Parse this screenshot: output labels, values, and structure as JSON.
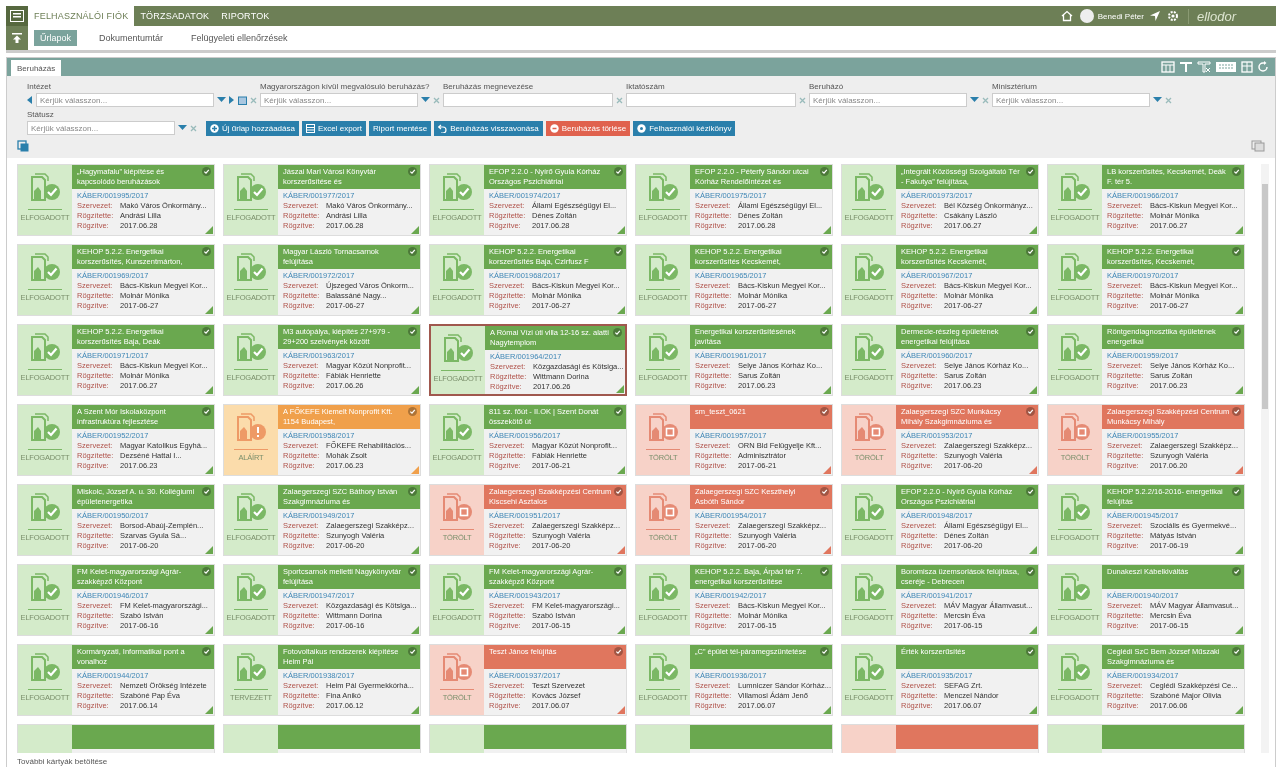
{
  "top_bar": {
    "tabs": [
      {
        "label": "FELHASZNÁLÓI FIÓK",
        "selected": true
      },
      {
        "label": "TÖRZSADATOK",
        "selected": false
      },
      {
        "label": "RIPORTOK",
        "selected": false
      }
    ],
    "user": "Benedi Péter",
    "logo": "ellodor"
  },
  "sub_nav": {
    "tabs": [
      {
        "label": "Űrlapok",
        "selected": true
      },
      {
        "label": "Dokumentumtár",
        "selected": false
      },
      {
        "label": "Felügyeleti ellenőrzések",
        "selected": false
      }
    ]
  },
  "panel": {
    "tab": "Beruházás"
  },
  "filters": [
    {
      "label": "Intézet",
      "placeholder": "Kérjük válasszon...",
      "kind": "nav-select"
    },
    {
      "label": "Magyarországon kívül megvalósuló beruházás?",
      "placeholder": "Kérjük válasszon...",
      "kind": "select"
    },
    {
      "label": "Beruházás megnevezése",
      "kind": "text"
    },
    {
      "label": "Iktatószám",
      "kind": "text"
    },
    {
      "label": "Beruházó",
      "placeholder": "Kérjük válasszon...",
      "kind": "select"
    },
    {
      "label": "Minisztérium",
      "placeholder": "Kérjük válasszon...",
      "kind": "select"
    },
    {
      "label": "Státusz",
      "placeholder": "Kérjük válasszon...",
      "kind": "select"
    }
  ],
  "actions": [
    {
      "label": "Új űrlap hozzáadása",
      "kind": "add",
      "color": "#2a7fab"
    },
    {
      "label": "Excel export",
      "kind": "excel",
      "color": "#2a7fab"
    },
    {
      "label": "Riport mentése",
      "kind": "plain",
      "color": "#2a7fab"
    },
    {
      "label": "Beruházás visszavonása",
      "kind": "undo",
      "color": "#2a7fab"
    },
    {
      "label": "Beruházás törlése",
      "kind": "delete",
      "color": "#e0624e"
    },
    {
      "label": "Felhasználói kézikönyv",
      "kind": "help",
      "color": "#2a7fab"
    }
  ],
  "cards": [
    {
      "kind": "accepted",
      "status_label": "ELFOGADOTT",
      "selected": false,
      "title": "„Hagymafalu” kiépítése és kapcsolódó beruházások",
      "id": "KÁBER/001995/2017",
      "org_label": "Szervezet:",
      "org": "Makó Város Önkormány...",
      "by_label": "Rögzítette:",
      "by": "Andrási Lilla",
      "date_label": "Rögzítve:",
      "date": "2017.06.28"
    },
    {
      "kind": "accepted",
      "status_label": "ELFOGADOTT",
      "selected": false,
      "title": "Jászai Mari Városi Könyvtár korszerűsítése és",
      "id": "KÁBER/001977/2017",
      "org_label": "Szervezet:",
      "org": "Makó Város Önkormány...",
      "by_label": "Rögzítette:",
      "by": "Andrási Lilla",
      "date_label": "Rögzítve:",
      "date": "2017.06.28"
    },
    {
      "kind": "accepted",
      "status_label": "ELFOGADOTT",
      "selected": false,
      "title": "EFOP 2.2.0 - Nyírő Gyula Kórház Országos Pszichiátriai",
      "id": "KÁBER/001974/2017",
      "org_label": "Szervezet:",
      "org": "Állami Egészségügyi El...",
      "by_label": "Rögzítette:",
      "by": "Dénes Zoltán",
      "date_label": "Rögzítve:",
      "date": "2017.06.28"
    },
    {
      "kind": "accepted",
      "status_label": "ELFOGADOTT",
      "selected": false,
      "title": "EFOP 2.2.0 - Péterfy Sándor utcai Kórház Rendelőintézet és",
      "id": "KÁBER/001975/2017",
      "org_label": "Szervezet:",
      "org": "Állami Egészségügyi El...",
      "by_label": "Rögzítette:",
      "by": "Dénes Zoltán",
      "date_label": "Rögzítve:",
      "date": "2017.06.28"
    },
    {
      "kind": "accepted",
      "status_label": "ELFOGADOTT",
      "selected": false,
      "title": "„Integrált Közösségi Szolgáltató Tér - Fakutya” felújítása,",
      "id": "KÁBER/001973/2017",
      "org_label": "Szervezet:",
      "org": "Bél Község Önkormányz...",
      "by_label": "Rögzítette:",
      "by": "Csákány László",
      "date_label": "Rögzítve:",
      "date": "2017.06.27"
    },
    {
      "kind": "accepted",
      "status_label": "ELFOGADOTT",
      "selected": false,
      "title": "LB korszerűsítés, Kecskemét, Deák F. tér 5.",
      "id": "KÁBER/001966/2017",
      "org_label": "Szervezet:",
      "org": "Bács-Kiskun Megyei Kor...",
      "by_label": "Rögzítette:",
      "by": "Molnár Mónika",
      "date_label": "Rögzítve:",
      "date": "2017.06.27"
    },
    {
      "kind": "accepted",
      "status_label": "ELFOGADOTT",
      "selected": false,
      "title": "KEHOP 5.2.2. Energetikai korszerűsítés, Kunszentmárton,",
      "id": "KÁBER/001969/2017",
      "org_label": "Szervezet:",
      "org": "Bács-Kiskun Megyei Kor...",
      "by_label": "Rögzítette:",
      "by": "Molnár Mónika",
      "date_label": "Rögzítve:",
      "date": "2017-06-27"
    },
    {
      "kind": "accepted",
      "status_label": "ELFOGADOTT",
      "selected": false,
      "title": "Magyar László Tornacsarnok felújítása",
      "id": "KÁBER/001972/2017",
      "org_label": "Szervezet:",
      "org": "Újszeged Város Önkorm...",
      "by_label": "Rögzítette:",
      "by": "Balassáné Nagy...",
      "date_label": "Rögzítve:",
      "date": "2017-06-27"
    },
    {
      "kind": "accepted",
      "status_label": "ELFOGADOTT",
      "selected": false,
      "title": "KEHOP 5.2.2. Energetikai korszerűsítés Baja, Czirfusz F",
      "id": "KÁBER/001968/2017",
      "org_label": "Szervezet:",
      "org": "Bács-Kiskun Megyei Kor...",
      "by_label": "Rögzítette:",
      "by": "Molnár Mónika",
      "date_label": "Rögzítve:",
      "date": "2017-06-27"
    },
    {
      "kind": "accepted",
      "status_label": "ELFOGADOTT",
      "selected": false,
      "title": "KEHOP 5.2.2. Energetikai korszerűsítés Kecskemét,",
      "id": "KÁBER/001965/2017",
      "org_label": "Szervezet:",
      "org": "Bács-Kiskun Megyei Kor...",
      "by_label": "Rögzítette:",
      "by": "Molnár Mónika",
      "date_label": "Rögzítve:",
      "date": "2017-06-27"
    },
    {
      "kind": "accepted",
      "status_label": "ELFOGADOTT",
      "selected": false,
      "title": "KEHOP 5.2.2. Energetikai korszerűsítés Kecskemét,",
      "id": "KÁBER/001967/2017",
      "org_label": "Szervezet:",
      "org": "Bács-Kiskun Megyei Kor...",
      "by_label": "Rögzítette:",
      "by": "Molnár Mónika",
      "date_label": "Rögzítve:",
      "date": "2017-06-27"
    },
    {
      "kind": "accepted",
      "status_label": "ELFOGADOTT",
      "selected": false,
      "title": "KEHOP 5.2.2. Energetikai korszerűsítés, Kecskemét,",
      "id": "KÁBER/001970/2017",
      "org_label": "Szervezet:",
      "org": "Bács-Kiskun Megyei Kor...",
      "by_label": "Rögzítette:",
      "by": "Molnár Mónika",
      "date_label": "Rögzítve:",
      "date": "2017-06-27"
    },
    {
      "kind": "accepted",
      "status_label": "ELFOGADOTT",
      "selected": false,
      "title": "KEHOP 5.2.2. Energetikai korszerűsítés Baja, Deák",
      "id": "KÁBER/001971/2017",
      "org_label": "Szervezet:",
      "org": "Bács-Kiskun Megyei Kor...",
      "by_label": "Rögzítette:",
      "by": "Molnár Mónika",
      "date_label": "Rögzítve:",
      "date": "2017.06.27"
    },
    {
      "kind": "accepted",
      "status_label": "ELFOGADOTT",
      "selected": false,
      "title": "M3 autópálya, kiépítés 27+979 - 29+200 szelvények között",
      "id": "KÁBER/001963/2017",
      "org_label": "Szervezet:",
      "org": "Magyar Közút Nonprofit...",
      "by_label": "Rögzítette:",
      "by": "Fábiák Henriette",
      "date_label": "Rögzítve:",
      "date": "2017.06.26"
    },
    {
      "kind": "accepted",
      "status_label": "ELFOGADOTT",
      "selected": true,
      "title": "A Római Vízi úti villa 12-16 sz. alatti Nagytemplom",
      "id": "KÁBER/001964/2017",
      "org_label": "Szervezet:",
      "org": "Közgazdasági és Kötsiga...",
      "by_label": "Rögzítette:",
      "by": "Wittmann Dorina",
      "date_label": "Rögzítve:",
      "date": "2017.06.26"
    },
    {
      "kind": "accepted",
      "status_label": "ELFOGADOTT",
      "selected": false,
      "title": "Energetikai korszerűsítésének javítása",
      "id": "KÁBER/001961/2017",
      "org_label": "Szervezet:",
      "org": "Selye János Kórház Ko...",
      "by_label": "Rögzítette:",
      "by": "Sarus Zoltán",
      "date_label": "Rögzítve:",
      "date": "2017.06.23"
    },
    {
      "kind": "accepted",
      "status_label": "ELFOGADOTT",
      "selected": false,
      "title": "Dermecie-részleg épületének energetikai felújítása",
      "id": "KÁBER/001960/2017",
      "org_label": "Szervezet:",
      "org": "Selye János Kórház Ko...",
      "by_label": "Rögzítette:",
      "by": "Sarus Zoltán",
      "date_label": "Rögzítve:",
      "date": "2017.06.23"
    },
    {
      "kind": "accepted",
      "status_label": "ELFOGADOTT",
      "selected": false,
      "title": "Röntgendiagnosztika épületének energetikai",
      "id": "KÁBER/001959/2017",
      "org_label": "Szervezet:",
      "org": "Selye János Kórház Ko...",
      "by_label": "Rögzítette:",
      "by": "Sarus Zoltán",
      "date_label": "Rögzítve:",
      "date": "2017.06.23"
    },
    {
      "kind": "accepted",
      "status_label": "ELFOGADOTT",
      "selected": false,
      "title": "A Szent Mór Iskolaközpont infrastruktúra fejlesztése",
      "id": "KÁBER/001952/2017",
      "org_label": "Szervezet:",
      "org": "Magyar Katolikus Egyhá...",
      "by_label": "Rögzítette:",
      "by": "Dezséné Hattal I...",
      "date_label": "Rögzítve:",
      "date": "2017.06.23"
    },
    {
      "kind": "signed",
      "status_label": "ALÁÍRT",
      "selected": false,
      "title": "A FŐKEFE Kiemelt Nonprofit Kft. 1154 Budapest,",
      "id": "KÁBER/001958/2017",
      "org_label": "Szervezet:",
      "org": "FŐKEFE Rehabilitációs...",
      "by_label": "Rögzítette:",
      "by": "Mohák Zsolt",
      "date_label": "Rögzítve:",
      "date": "2017.06.23"
    },
    {
      "kind": "accepted",
      "status_label": "ELFOGADOTT",
      "selected": false,
      "title": "811 sz. főút - II.OK | Szent Donát összekötő út",
      "id": "KÁBER/001956/2017",
      "org_label": "Szervezet:",
      "org": "Magyar Közút Nonprofit...",
      "by_label": "Rögzítette:",
      "by": "Fábiák Henriette",
      "date_label": "Rögzítve:",
      "date": "2017-06-21"
    },
    {
      "kind": "deleted",
      "status_label": "TÖRÖLT",
      "selected": false,
      "title": "sm_teszt_0621",
      "id": "KÁBER/001957/2017",
      "org_label": "Szervezet:",
      "org": "ORN Bld Felügyelje Kft...",
      "by_label": "Rögzítette:",
      "by": "Adminisztrátor",
      "date_label": "Rögzítve:",
      "date": "2017-06-21"
    },
    {
      "kind": "deleted",
      "status_label": "TÖRÖLT",
      "selected": false,
      "title": "Zalaegerszegi SZC Munkácsy Mihály Szakgimnáziuma és",
      "id": "KÁBER/001953/2017",
      "org_label": "Szervezet:",
      "org": "Zalaegerszegi Szakképz...",
      "by_label": "Rögzítette:",
      "by": "Szunyogh Valéria",
      "date_label": "Rögzítve:",
      "date": "2017-06-20"
    },
    {
      "kind": "deleted",
      "status_label": "TÖRÖLT",
      "selected": false,
      "title": "Zalaegerszegi Szakképzési Centrum Munkácsy Mihály",
      "id": "KÁBER/001955/2017",
      "org_label": "Szervezet:",
      "org": "Zalaegerszegi Szakképz...",
      "by_label": "Rögzítette:",
      "by": "Szunyogh Valéria",
      "date_label": "Rögzítve:",
      "date": "2017.06.20"
    },
    {
      "kind": "accepted",
      "status_label": "ELFOGADOTT",
      "selected": false,
      "title": "Miskolc, József A. u. 30. Kollégiumi épületenergetika",
      "id": "KÁBER/001950/2017",
      "org_label": "Szervezet:",
      "org": "Borsod-Abaúj-Zemplén...",
      "by_label": "Rögzítette:",
      "by": "Szarvas Gyula Sá...",
      "date_label": "Rögzítve:",
      "date": "2017-06-20"
    },
    {
      "kind": "accepted",
      "status_label": "ELFOGADOTT",
      "selected": false,
      "title": "Zalaegerszegi SZC Báthory István Szakgimnáziuma és",
      "id": "KÁBER/001949/2017",
      "org_label": "Szervezet:",
      "org": "Zalaegerszegi Szakképz...",
      "by_label": "Rögzítette:",
      "by": "Szunyogh Valéria",
      "date_label": "Rögzítve:",
      "date": "2017-06-20"
    },
    {
      "kind": "deleted",
      "status_label": "TÖRÖLT",
      "selected": false,
      "title": "Zalaegerszegi Szakképzési Centrum Kiscsehi Asztalos",
      "id": "KÁBER/001951/2017",
      "org_label": "Szervezet:",
      "org": "Zalaegerszegi Szakképz...",
      "by_label": "Rögzítette:",
      "by": "Szunyogh Valéria",
      "date_label": "Rögzítve:",
      "date": "2017-06-20"
    },
    {
      "kind": "deleted",
      "status_label": "TÖRÖLT",
      "selected": false,
      "title": "Zalaegerszegi SZC Keszthelyi Asbóth Sándor",
      "id": "KÁBER/001954/2017",
      "org_label": "Szervezet:",
      "org": "Zalaegerszegi Szakképz...",
      "by_label": "Rögzítette:",
      "by": "Szunyogh Valéria",
      "date_label": "Rögzítve:",
      "date": "2017-06-20"
    },
    {
      "kind": "accepted",
      "status_label": "ELFOGADOTT",
      "selected": false,
      "title": "EFOP 2.2.0 - Nyírő Gyula Kórház Országos Pszichiátriai",
      "id": "KÁBER/001948/2017",
      "org_label": "Szervezet:",
      "org": "Állami Egészségügyi El...",
      "by_label": "Rögzítette:",
      "by": "Dénes Zoltán",
      "date_label": "Rögzítve:",
      "date": "2017-06-20"
    },
    {
      "kind": "accepted",
      "status_label": "ELFOGADOTT",
      "selected": false,
      "title": "KEHOP 5.2.2/16-2016- energetikai felújítás",
      "id": "KÁBER/001945/2017",
      "org_label": "Szervezet:",
      "org": "Szociális és Gyermekvé...",
      "by_label": "Rögzítette:",
      "by": "Mátyás István",
      "date_label": "Rögzítve:",
      "date": "2017-06-19"
    },
    {
      "kind": "accepted",
      "status_label": "ELFOGADOTT",
      "selected": false,
      "title": "FM Kelet-magyarországi Agrár-szakképző Központ",
      "id": "KÁBER/001946/2017",
      "org_label": "Szervezet:",
      "org": "FM Kelet-magyarországi...",
      "by_label": "Rögzítette:",
      "by": "Szabó István",
      "date_label": "Rögzítve:",
      "date": "2017-06-16"
    },
    {
      "kind": "accepted",
      "status_label": "ELFOGADOTT",
      "selected": false,
      "title": "Sportcsarnok melletti Nagykönyvtár felújítása",
      "id": "KÁBER/001947/2017",
      "org_label": "Szervezet:",
      "org": "Közgazdasági és Kötsiga...",
      "by_label": "Rögzítette:",
      "by": "Wittmann Dorina",
      "date_label": "Rögzítve:",
      "date": "2017-06-16"
    },
    {
      "kind": "accepted",
      "status_label": "ELFOGADOTT",
      "selected": false,
      "title": "FM Kelet-magyarországi Agrár-szakképző Központ",
      "id": "KÁBER/001943/2017",
      "org_label": "Szervezet:",
      "org": "FM Kelet-magyarországi...",
      "by_label": "Rögzítette:",
      "by": "Szabó István",
      "date_label": "Rögzítve:",
      "date": "2017-06-15"
    },
    {
      "kind": "accepted",
      "status_label": "ELFOGADOTT",
      "selected": false,
      "title": "KEHOP 5.2.2. Baja, Árpád tér 7. energetikai korszerűsítése",
      "id": "KÁBER/001942/2017",
      "org_label": "Szervezet:",
      "org": "Bács-Kiskun Megyei Kor...",
      "by_label": "Rögzítette:",
      "by": "Molnár Mónika",
      "date_label": "Rögzítve:",
      "date": "2017-06-15"
    },
    {
      "kind": "accepted",
      "status_label": "ELFOGADOTT",
      "selected": false,
      "title": "Boromisza üzemsorlások felújítása, cseréje - Debrecen",
      "id": "KÁBER/001941/2017",
      "org_label": "Szervezet:",
      "org": "MÁV Magyar Államvasut...",
      "by_label": "Rögzítette:",
      "by": "Mercsin Éva",
      "date_label": "Rögzítve:",
      "date": "2017-06-15"
    },
    {
      "kind": "accepted",
      "status_label": "ELFOGADOTT",
      "selected": false,
      "title": "Dunakeszi Kábelkiváltás",
      "id": "KÁBER/001940/2017",
      "org_label": "Szervezet:",
      "org": "MÁV Magyar Államvasut...",
      "by_label": "Rögzítette:",
      "by": "Mercsin Éva",
      "date_label": "Rögzítve:",
      "date": "2017-06-15"
    },
    {
      "kind": "accepted",
      "status_label": "ELFOGADOTT",
      "selected": false,
      "title": "Kormányzati, Informatikai pont a vonalhoz",
      "id": "KÁBER/001944/2017",
      "org_label": "Szervezet:",
      "org": "Nemzeti Örökség Intézete",
      "by_label": "Rögzítette:",
      "by": "Szabóné Pap Éva",
      "date_label": "Rögzítve:",
      "date": "2017.06.14"
    },
    {
      "kind": "accepted",
      "status_label": "TERVEZETT",
      "selected": false,
      "title": "Fotovoltaikus rendszerek kiépítése Heim Pál",
      "id": "KÁBER/001938/2017",
      "org_label": "Szervezet:",
      "org": "Heim Pál Gyermekkórhá...",
      "by_label": "Rögzítette:",
      "by": "Fina Anikó",
      "date_label": "Rögzítve:",
      "date": "2017.06.12"
    },
    {
      "kind": "deleted",
      "status_label": "TÖRÖLT",
      "selected": false,
      "title": "Teszt János felújítás",
      "id": "KÁBER/001937/2017",
      "org_label": "Szervezet:",
      "org": "Teszt Szervezet",
      "by_label": "Rögzítette:",
      "by": "Kovács József",
      "date_label": "Rögzítve:",
      "date": "2017.06.07"
    },
    {
      "kind": "accepted",
      "status_label": "ELFOGADOTT",
      "selected": false,
      "title": "„C” épület tél-páramegszüntetése",
      "id": "KÁBER/001936/2017",
      "org_label": "Szervezet:",
      "org": "Lumniczer Sándor Kórház...",
      "by_label": "Rögzítette:",
      "by": "Villamosi Ádám Jenő",
      "date_label": "Rögzítve:",
      "date": "2017.06.07"
    },
    {
      "kind": "accepted",
      "status_label": "ELFOGADOTT",
      "selected": false,
      "title": "Érték korszerűsítés",
      "id": "KÁBER/001935/2017",
      "org_label": "Szervezet:",
      "org": "SEFAG Zrt.",
      "by_label": "Rögzítette:",
      "by": "Menczel Nándor",
      "date_label": "Rögzítve:",
      "date": "2017.06.07"
    },
    {
      "kind": "accepted",
      "status_label": "ELFOGADOTT",
      "selected": false,
      "title": "Ceglédi SzC Bem József Műszaki Szakgimnáziuma és",
      "id": "KÁBER/001934/2017",
      "org_label": "Szervezet:",
      "org": "Ceglédi Szakképzési Ce...",
      "by_label": "Rögzítette:",
      "by": "Szabóné Major Olivia",
      "date_label": "Rögzítve:",
      "date": "2017.06.06"
    }
  ],
  "partial_cards": [
    {
      "kind": "accepted"
    },
    {
      "kind": "accepted"
    },
    {
      "kind": "accepted"
    },
    {
      "kind": "accepted"
    },
    {
      "kind": "deleted"
    },
    {
      "kind": "accepted"
    }
  ],
  "footer": {
    "load_more": "További kártyák betöltése"
  }
}
